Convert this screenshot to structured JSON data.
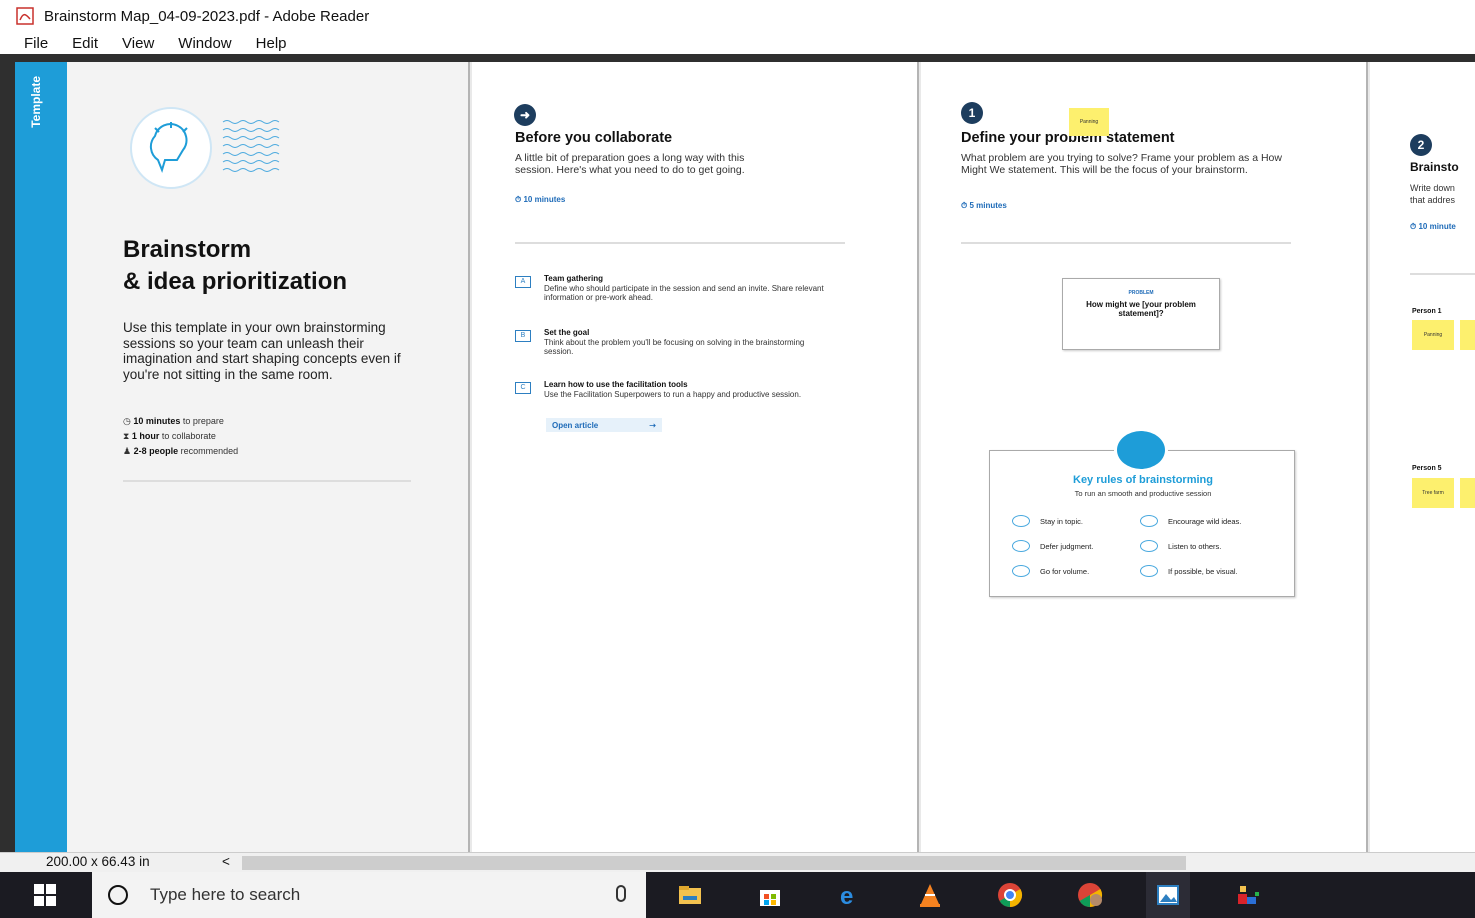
{
  "window": {
    "title": "Brainstorm Map_04-09-2023.pdf - Adobe Reader"
  },
  "menu": [
    "File",
    "Edit",
    "View",
    "Window",
    "Help"
  ],
  "page1": {
    "tab_label": "Template",
    "title_line1": "Brainstorm",
    "title_line2": "& idea prioritization",
    "description": "Use this template in your own brainstorming sessions so your team can unleash their imagination and start shaping concepts even if you're not sitting in the same room.",
    "meta": [
      {
        "bold": "10 minutes",
        "rest": " to prepare"
      },
      {
        "bold": "1 hour",
        "rest": " to collaborate"
      },
      {
        "bold": "2-8 people",
        "rest": " recommended"
      }
    ]
  },
  "page2": {
    "heading": "Before you collaborate",
    "sub": "A little bit of preparation goes a long way with this session. Here's what you need to do to get going.",
    "time": "10 minutes",
    "items": [
      {
        "icon": "A",
        "title": "Team gathering",
        "desc": "Define who should participate in the session and send an invite. Share relevant information or pre-work ahead."
      },
      {
        "icon": "B",
        "title": "Set the goal",
        "desc": "Think about the problem you'll be focusing on solving in the brainstorming session."
      },
      {
        "icon": "C",
        "title": "Learn how to use the facilitation tools",
        "desc": "Use the Facilitation Superpowers to run a happy and productive session."
      }
    ],
    "open_article": "Open article"
  },
  "page3": {
    "step": "1",
    "heading": "Define your problem statement",
    "sticky": "Panning",
    "sub": "What problem are you trying to solve? Frame your problem as a How Might We statement. This will be the focus of your brainstorm.",
    "time": "5 minutes",
    "problem_label": "PROBLEM",
    "problem_text": "How might we [your problem statement]?",
    "rules_title": "Key rules of brainstorming",
    "rules_sub": "To run an smooth and productive session",
    "rules": [
      "Stay in topic.",
      "Encourage wild ideas.",
      "Defer judgment.",
      "Listen to others.",
      "Go for volume.",
      "If possible, be visual."
    ]
  },
  "page4": {
    "step": "2",
    "heading": "Brainsto",
    "sub": "Write down\nthat addres",
    "time": "10 minute",
    "person1": "Person 1",
    "person5": "Person 5",
    "sticky_p1": "Panning",
    "sticky_p5": "Tree farm"
  },
  "status": {
    "dimensions": "200.00 x 66.43 in",
    "scroll_left": "<"
  },
  "taskbar": {
    "search_placeholder": "Type here to search"
  }
}
